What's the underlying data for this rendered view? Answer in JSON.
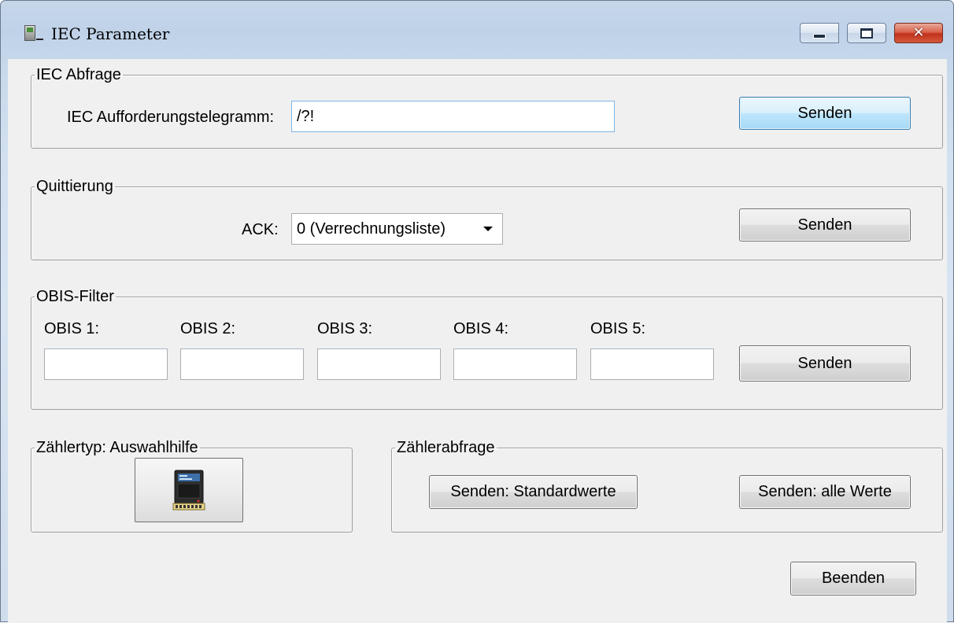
{
  "window": {
    "title": "IEC Parameter",
    "controls": {
      "minimize": "minimize",
      "maximize": "maximize",
      "close": "close"
    }
  },
  "iec_abfrage": {
    "legend": "IEC Abfrage",
    "label": "IEC Aufforderungstelegramm:",
    "value": "/?!",
    "send_label": "Senden"
  },
  "quittierung": {
    "legend": "Quittierung",
    "label": "ACK:",
    "selected": "0 (Verrechnungsliste)",
    "send_label": "Senden"
  },
  "obis_filter": {
    "legend": "OBIS-Filter",
    "fields": [
      {
        "label": "OBIS 1:",
        "value": ""
      },
      {
        "label": "OBIS 2:",
        "value": ""
      },
      {
        "label": "OBIS 3:",
        "value": ""
      },
      {
        "label": "OBIS 4:",
        "value": ""
      },
      {
        "label": "OBIS 5:",
        "value": ""
      }
    ],
    "send_label": "Senden"
  },
  "zaehlertyp": {
    "legend": "Zählertyp: Auswahlhilfe",
    "icon": "electricity-meter-icon"
  },
  "zaehlerabfrage": {
    "legend": "Zählerabfrage",
    "standard_label": "Senden: Standardwerte",
    "all_label": "Senden: alle Werte"
  },
  "footer": {
    "close_label": "Beenden"
  },
  "colors": {
    "title_glass": "#c6d6e9",
    "client_bg": "#f0f0f0",
    "default_button": "#bee6fd",
    "close_button": "#c2311c"
  }
}
